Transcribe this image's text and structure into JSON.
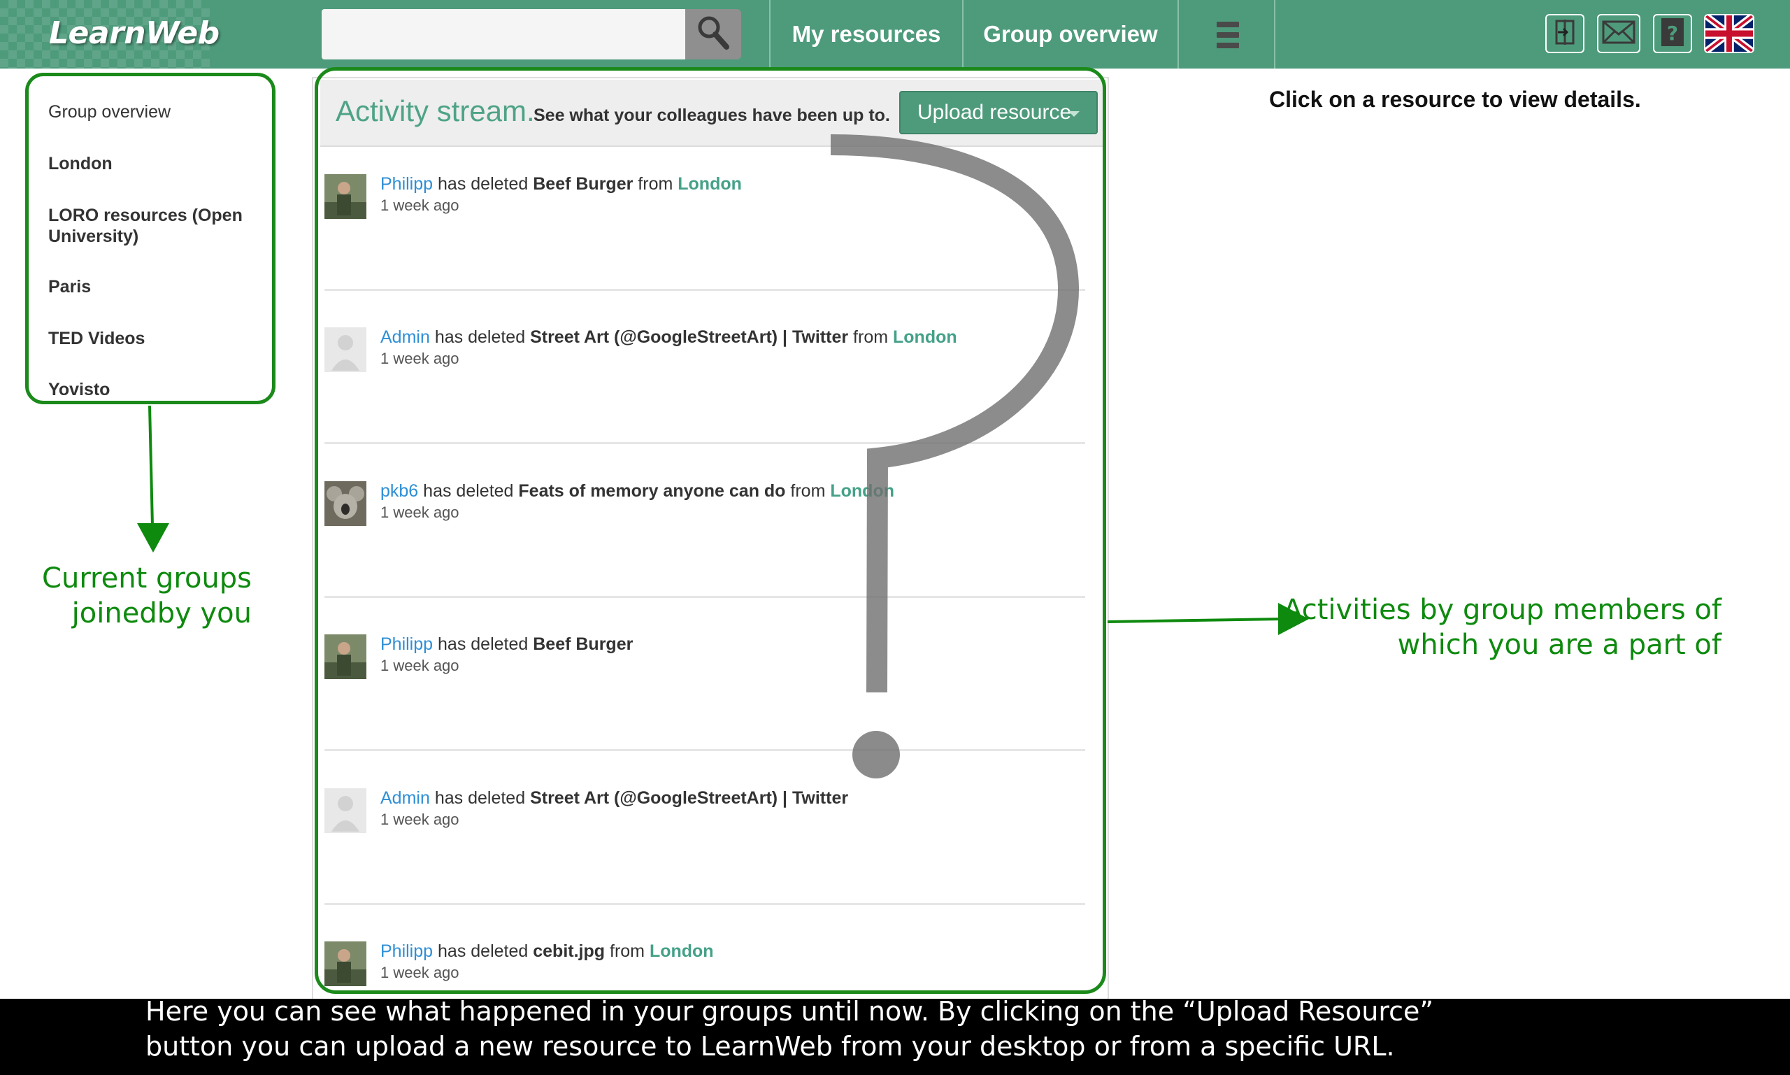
{
  "app": {
    "logo": "LearnWeb"
  },
  "search": {
    "value": "",
    "placeholder": ""
  },
  "nav": {
    "my_resources": "My resources",
    "group_overview": "Group overview"
  },
  "toolbar": {
    "icons": [
      "logout-icon",
      "mail-icon",
      "help-icon",
      "uk-flag-icon"
    ]
  },
  "hint": "Click on a resource to view details.",
  "sidebar": {
    "items": [
      {
        "label": "Group overview"
      },
      {
        "label": "London"
      },
      {
        "label": "LORO resources (Open University)"
      },
      {
        "label": "Paris"
      },
      {
        "label": "TED Videos"
      },
      {
        "label": "Yovisto"
      }
    ]
  },
  "stream": {
    "title": "Activity stream.",
    "subtitle": "See what your colleagues have been up to.",
    "upload_label": "Upload resource",
    "activities": [
      {
        "user": "Philipp",
        "verb": "has deleted",
        "resource": "Beef Burger",
        "prep": "from",
        "group": "London",
        "time": "1 week ago"
      },
      {
        "user": "Admin",
        "verb": "has deleted",
        "resource": "Street Art (@GoogleStreetArt) | Twitter",
        "prep": "from",
        "group": "London",
        "time": "1 week ago"
      },
      {
        "user": "pkb6",
        "verb": "has deleted",
        "resource": "Feats of memory anyone can do",
        "prep": "from",
        "group": "London",
        "time": "1 week ago"
      },
      {
        "user": "Philipp",
        "verb": "has deleted",
        "resource": "Beef Burger",
        "prep": "",
        "group": "",
        "time": "1 week ago"
      },
      {
        "user": "Admin",
        "verb": "has deleted",
        "resource": "Street Art (@GoogleStreetArt) | Twitter",
        "prep": "",
        "group": "",
        "time": "1 week ago"
      },
      {
        "user": "Philipp",
        "verb": "has deleted",
        "resource": "cebit.jpg",
        "prep": "from",
        "group": "London",
        "time": "1 week ago"
      }
    ]
  },
  "callouts": {
    "left": "Current groups joinedby you",
    "right": "Activities by group members of which you are a part of"
  },
  "caption": {
    "line1": "Here you can see what happened in your groups until now. By clicking on the “Upload Resource”",
    "line2": "button you can upload a new resource to LearnWeb from your desktop or from a specific URL."
  },
  "colors": {
    "brand": "#4e9b7c",
    "annotation": "#1b8a1b",
    "link_user": "#2f8fd6",
    "link_group": "#44a188"
  }
}
